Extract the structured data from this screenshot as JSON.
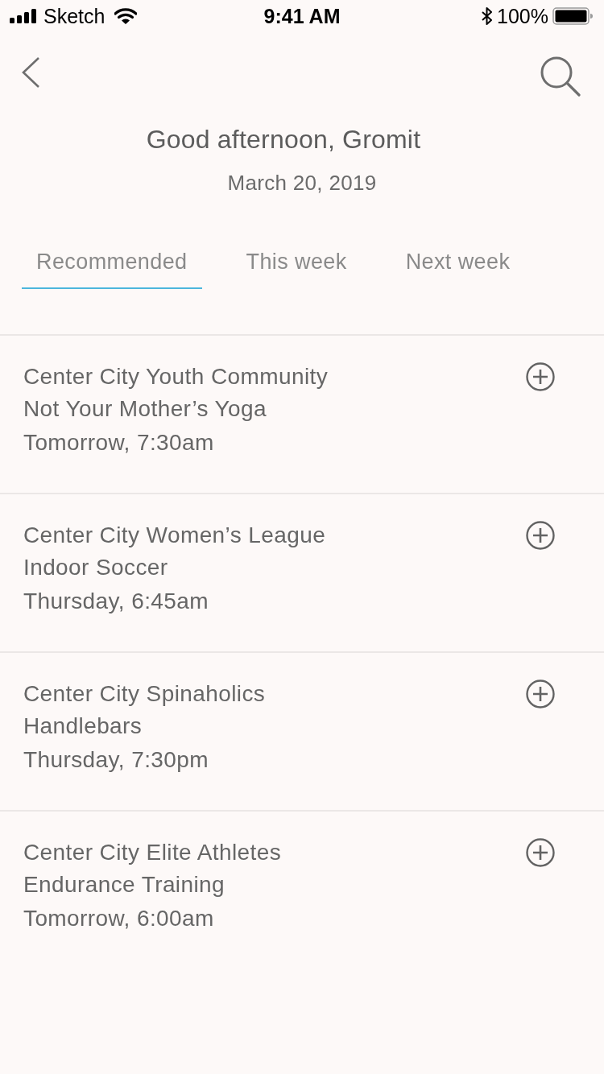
{
  "status_bar": {
    "carrier": "Sketch",
    "time": "9:41 AM",
    "battery": "100%"
  },
  "header": {
    "greeting": "Good afternoon, Gromit",
    "date": "March 20, 2019"
  },
  "tabs": [
    {
      "label": "Recommended",
      "selected": true
    },
    {
      "label": "This week",
      "selected": false
    },
    {
      "label": "Next week",
      "selected": false
    }
  ],
  "events": [
    {
      "group": "Center City Youth Community",
      "activity": "Not Your Mother’s Yoga",
      "time": "Tomorrow, 7:30am"
    },
    {
      "group": "Center City Women’s League",
      "activity": "Indoor Soccer",
      "time": "Thursday, 6:45am"
    },
    {
      "group": "Center City Spinaholics",
      "activity": "Handlebars",
      "time": "Thursday, 7:30pm"
    },
    {
      "group": "Center City Elite Athletes",
      "activity": "Endurance Training",
      "time": "Tomorrow, 6:00am"
    }
  ]
}
